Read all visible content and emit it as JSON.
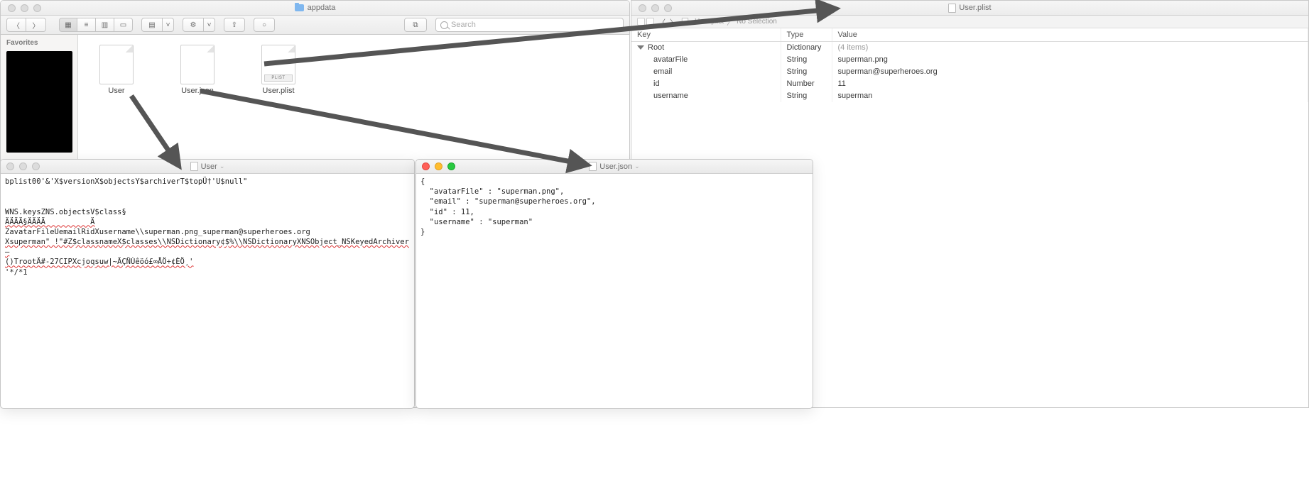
{
  "finder": {
    "title": "appdata",
    "search_placeholder": "Search",
    "sidebar": {
      "favorites": "Favorites"
    },
    "files": [
      {
        "name": "User",
        "kind": "blank"
      },
      {
        "name": "User.json",
        "kind": "blank"
      },
      {
        "name": "User.plist",
        "kind": "plist",
        "badge": "PLIST"
      }
    ]
  },
  "plist": {
    "title": "User.plist",
    "breadcrumb": {
      "file": "User.plist",
      "selection": "No Selection"
    },
    "headers": {
      "key": "Key",
      "type": "Type",
      "value": "Value"
    },
    "root": {
      "key": "Root",
      "type": "Dictionary",
      "value": "(4 items)"
    },
    "rows": [
      {
        "key": "avatarFile",
        "type": "String",
        "value": "superman.png"
      },
      {
        "key": "email",
        "type": "String",
        "value": "superman@superheroes.org"
      },
      {
        "key": "id",
        "type": "Number",
        "value": "11"
      },
      {
        "key": "username",
        "type": "String",
        "value": "superman"
      }
    ]
  },
  "textedit_user": {
    "title": "User",
    "lines": [
      "bplist00'&'X$versionX$objectsY$archiverT$topÜ†'U$null\"",
      "",
      "",
      "WNS.keysZNS.objectsV$class§",
      "ÄÄÄÄ§ÄÄÄÄ          Ä",
      "ZavatarFileUemailRidXusername\\\\superman.png_superman@superheroes.org",
      "Xsuperman\" !\"#Z$classnameX$classes\\\\NSDictionary¢$%\\\\NSDictionaryXNSObject_NSKeyedArchiver—",
      "()TrootÄ#-27CIPXcjoqsuw|~ÃÇÑÙêöó£∞ÅÖ÷¢ÈÖ¸'",
      "'*/*1"
    ],
    "squiggles": [
      4,
      6,
      7
    ]
  },
  "textedit_json": {
    "title": "User.json",
    "content": "{\n  \"avatarFile\" : \"superman.png\",\n  \"email\" : \"superman@superheroes.org\",\n  \"id\" : 11,\n  \"username\" : \"superman\"\n}"
  }
}
